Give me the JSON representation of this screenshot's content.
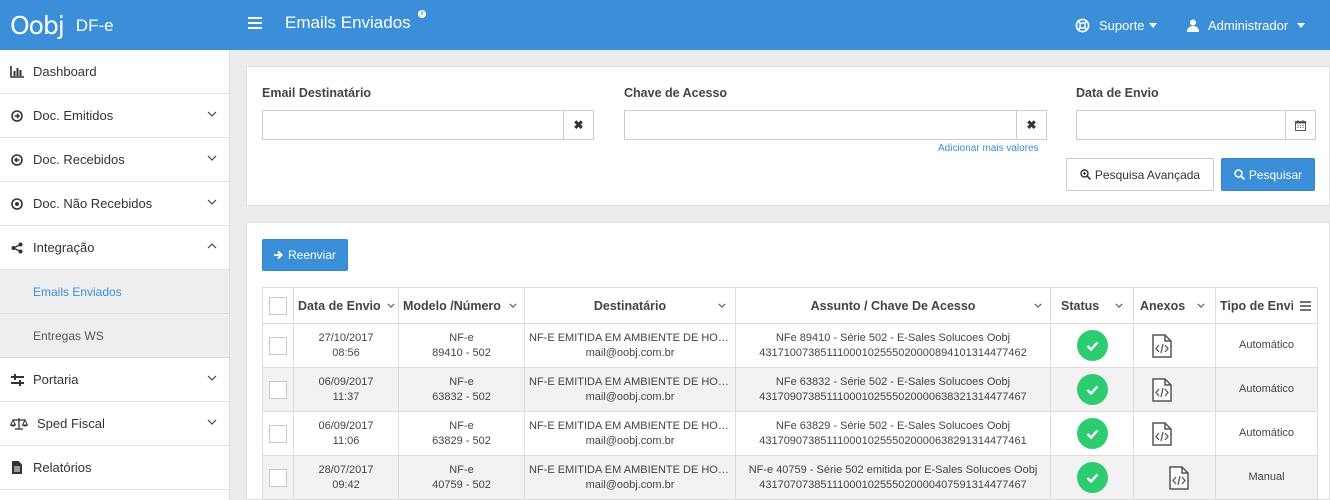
{
  "header": {
    "logo_mark": "Oobj",
    "logo_sub": "DF-e",
    "page_title": "Emails Enviados",
    "info_badge": "i",
    "support_label": "Suporte",
    "admin_label": "Administrador"
  },
  "sidebar": {
    "items": [
      {
        "label": "Dashboard"
      },
      {
        "label": "Doc. Emitidos"
      },
      {
        "label": "Doc. Recebidos"
      },
      {
        "label": "Doc. Não Recebidos"
      },
      {
        "label": "Integração"
      },
      {
        "label": "Emails Enviados"
      },
      {
        "label": "Entregas WS"
      },
      {
        "label": "Portaria"
      },
      {
        "label": "Sped Fiscal"
      },
      {
        "label": "Relatórios"
      }
    ]
  },
  "filters": {
    "email_label": "Email Destinatário",
    "email_value": "",
    "chave_label": "Chave de Acesso",
    "chave_value": "",
    "add_values_link": "Adicionar mais valores",
    "data_label": "Data de Envio",
    "data_value": "",
    "advanced_search_label": "Pesquisa Avançada",
    "search_label": "Pesquisar"
  },
  "actions": {
    "resend_label": "Reenviar"
  },
  "table": {
    "columns": [
      "Data de Envio",
      "Modelo /Número",
      "Destinatário",
      "Assunto / Chave De Acesso",
      "Status",
      "Anexos",
      "Tipo de Envio"
    ],
    "rows": [
      {
        "date": "27/10/2017",
        "time": "08:56",
        "model": "NF-e",
        "number": "89410 - 502",
        "dest_name": "NF-E EMITIDA EM AMBIENTE DE HOMOLOGACAO",
        "dest_email": "mail@oobj.com.br",
        "subject": "NFe 89410 - Série 502 - E-Sales Solucoes Oobj",
        "key": "43171007385111000102555020000894101314477462",
        "status": "ok",
        "type": "Automático"
      },
      {
        "date": "06/09/2017",
        "time": "11:37",
        "model": "NF-e",
        "number": "63832 - 502",
        "dest_name": "NF-E EMITIDA EM AMBIENTE DE HOMOLOGACAO",
        "dest_email": "mail@oobj.com.br",
        "subject": "NFe 63832 - Série 502 - E-Sales Solucoes Oobj",
        "key": "43170907385111000102555020000638321314477467",
        "status": "ok",
        "type": "Automático"
      },
      {
        "date": "06/09/2017",
        "time": "11:06",
        "model": "NF-e",
        "number": "63829 - 502",
        "dest_name": "NF-E EMITIDA EM AMBIENTE DE HOMOLOGACAO",
        "dest_email": "mail@oobj.com.br",
        "subject": "NFe 63829 - Série 502 - E-Sales Solucoes Oobj",
        "key": "43170907385111000102555020000638291314477461",
        "status": "ok",
        "type": "Automático"
      },
      {
        "date": "28/07/2017",
        "time": "09:42",
        "model": "NF-e",
        "number": "40759 - 502",
        "dest_name": "NF-E EMITIDA EM AMBIENTE DE HOMOLOGACAO",
        "dest_email": "mail@oobj.com.br",
        "subject": "NF-e 40759 - Série 502 emitida por E-Sales Solucoes Oobj",
        "key": "43170707385111000102555020000407591314477467",
        "status": "ok",
        "type": "Manual"
      }
    ]
  },
  "colors": {
    "primary": "#3a8fd8",
    "status_ok": "#2ecc71",
    "active_link": "#3a8fd8"
  }
}
